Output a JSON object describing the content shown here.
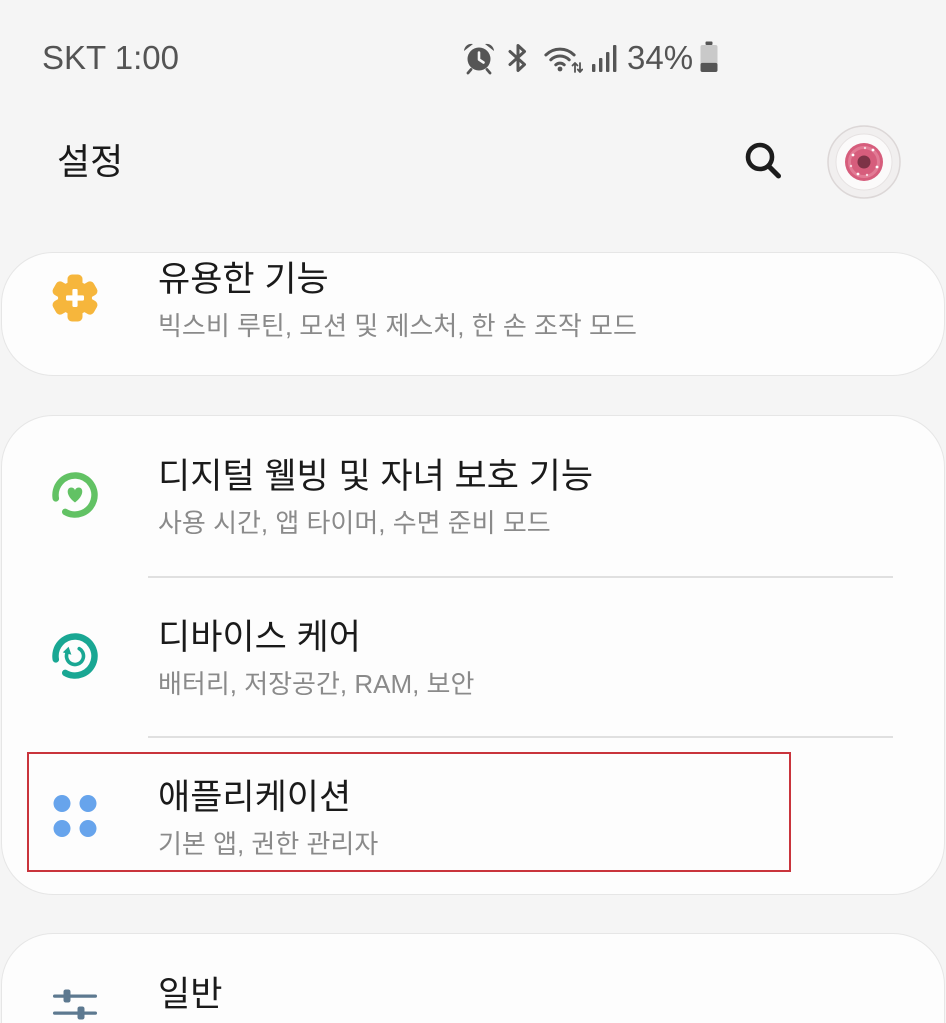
{
  "status_bar": {
    "carrier_time": "SKT 1:00",
    "battery_percent": "34%",
    "icons": [
      "alarm-icon",
      "bluetooth-icon",
      "wifi-icon",
      "signal-icon",
      "battery-icon"
    ]
  },
  "header": {
    "title": "설정",
    "actions": [
      "search-icon",
      "avatar-icon"
    ]
  },
  "groups": [
    {
      "items": [
        {
          "title": "유용한 기능",
          "subtitle": "빅스비 루틴, 모션 및 제스처, 한 손 조작 모드",
          "icon": "gear-plus-icon",
          "icon_color": "#f6b63c"
        }
      ]
    },
    {
      "items": [
        {
          "title": "디지털 웰빙 및 자녀 보호 기능",
          "subtitle": "사용 시간, 앱 타이머, 수면 준비 모드",
          "icon": "wellbeing-heart-icon",
          "icon_color": "#62c264"
        },
        {
          "title": "디바이스 케어",
          "subtitle": "배터리, 저장공간, RAM, 보안",
          "icon": "device-care-icon",
          "icon_color": "#19a793"
        },
        {
          "title": "애플리케이션",
          "subtitle": "기본 앱, 권한 관리자",
          "icon": "apps-grid-icon",
          "icon_color": "#67a4ec"
        }
      ]
    },
    {
      "items": [
        {
          "title": "일반",
          "icon": "sliders-icon",
          "icon_color": "#5d7990"
        }
      ]
    }
  ],
  "highlight": {
    "color": "#c9343c"
  },
  "colors": {
    "background": "#f5f5f5",
    "card": "#fdfdfd",
    "title_text": "#1a1a1a",
    "subtitle_text": "#8a8a8a"
  }
}
